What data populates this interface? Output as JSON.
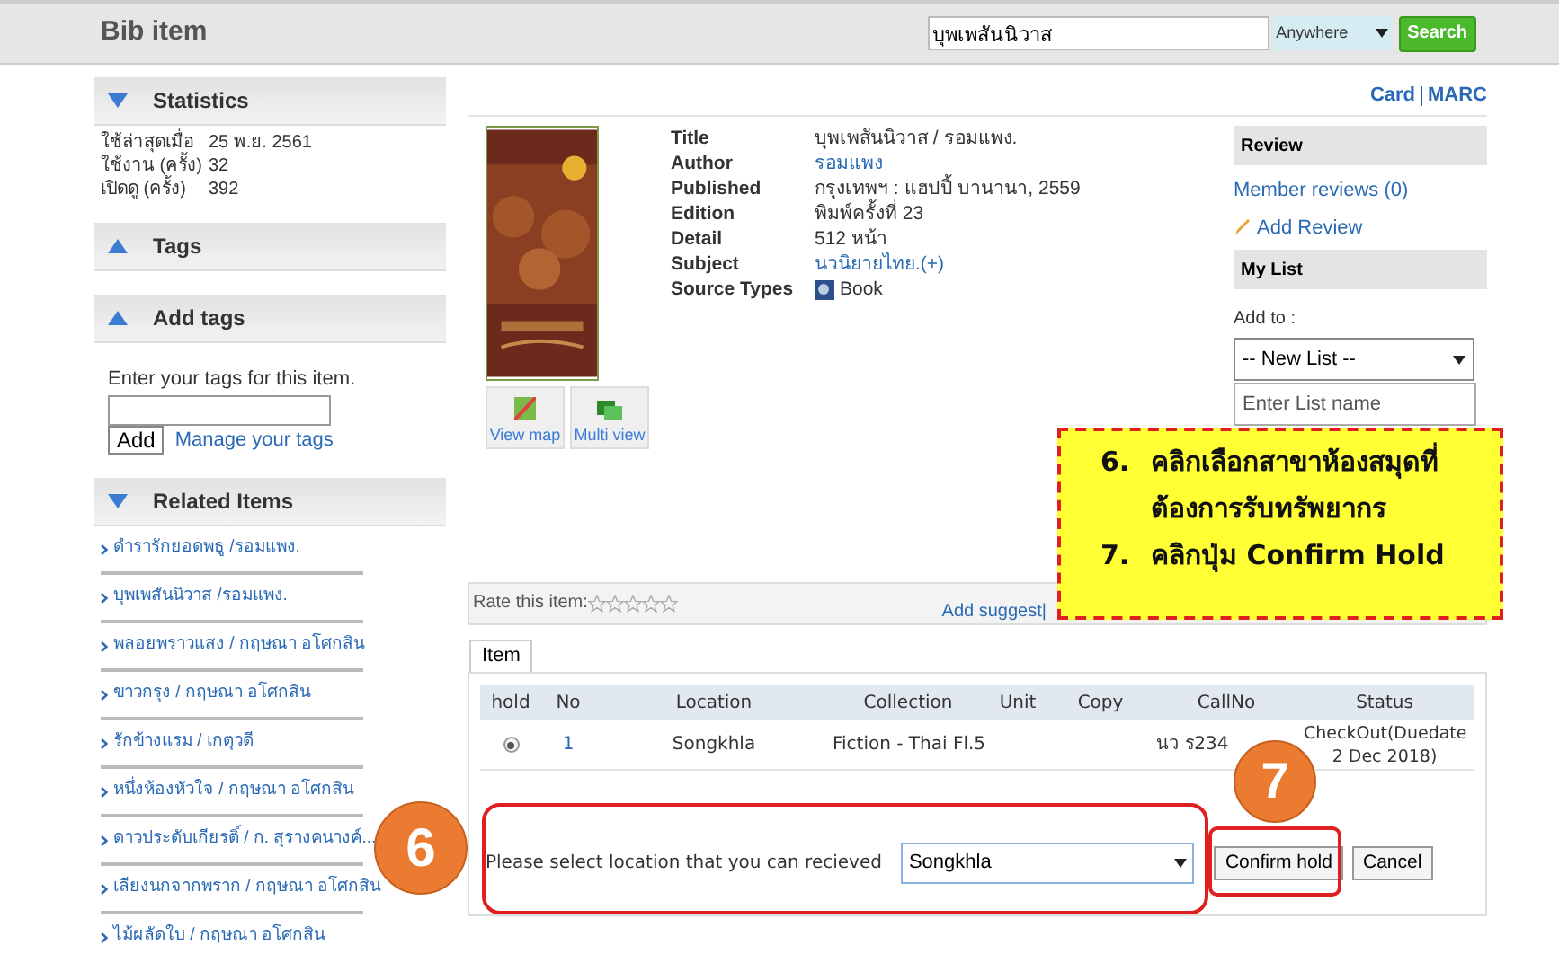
{
  "header": {
    "title": "Bib item",
    "search_value": "บุพเพสันนิวาส",
    "scope": "Anywhere",
    "search_button": "Search"
  },
  "sidebar": [
    {
      "title": "Statistics",
      "expanded": true,
      "kind": "stats",
      "rows": [
        {
          "label": "ใช้ล่าสุดเมื่อ",
          "value": "25 พ.ย. 2561"
        },
        {
          "label": "ใช้งาน (ครั้ง)",
          "value": "32"
        },
        {
          "label": "เปิดดู (ครั้ง)",
          "value": "392"
        }
      ]
    },
    {
      "title": "Tags",
      "expanded": false,
      "kind": "empty"
    },
    {
      "title": "Add tags",
      "expanded": false,
      "kind": "tags",
      "hint": "Enter your tags for this item.",
      "button": "Add",
      "link": "Manage your tags"
    },
    {
      "title": "Related Items",
      "expanded": true,
      "kind": "links",
      "items": [
        "ดำรารักยอดพธู /รอมแพง.",
        "บุพเพสันนิวาส /รอมแพง.",
        "พลอยพราวแสง / กฤษณา อโศกสิน",
        "ขาวกรุง / กฤษณา อโศกสิน",
        "รักข้างแรม / เกตุวดี",
        "หนึ่งห้องหัวใจ / กฤษณา อโศกสิน",
        "ดาวประดับเกียรติ์ / ก. สุรางคนางค์...",
        "เลียงนกจากพราก / กฤษณา อโศกสิน",
        "ไม้ผลัดใบ / กฤษณา อโศกสิน"
      ]
    }
  ],
  "views": [
    "Card",
    "MARC"
  ],
  "record": {
    "fields": [
      {
        "label": "Title",
        "value": "บุพเพสันนิวาส / รอมแพง.",
        "kind": "text"
      },
      {
        "label": "Author",
        "value": "รอมแพง",
        "kind": "link"
      },
      {
        "label": "Published",
        "value": "กรุงเทพฯ : แฮปปี้ บานานา, 2559",
        "kind": "text"
      },
      {
        "label": "Edition",
        "value": "พิมพ์ครั้งที่ 23",
        "kind": "text"
      },
      {
        "label": "Detail",
        "value": "512 หน้า",
        "kind": "text"
      },
      {
        "label": "Subject",
        "value": "นวนิยายไทย.(+)",
        "kind": "link"
      },
      {
        "label": "Source Types",
        "value": "Book",
        "kind": "type"
      }
    ],
    "cover_buttons": [
      "View map",
      "Multi view"
    ]
  },
  "review": {
    "title": "Review",
    "member_reviews": "Member reviews (0)",
    "add_review": "Add Review"
  },
  "my_list": {
    "title": "My List",
    "add_to": "Add to :",
    "list_value": "-- New List --",
    "name_placeholder": "Enter List name"
  },
  "rating": {
    "label": "Rate this item:",
    "stars": 0,
    "links": [
      "Add suggest|"
    ]
  },
  "tabs": [
    {
      "label": "Item",
      "selected": true
    }
  ],
  "items": {
    "columns": [
      "hold",
      "No",
      "Location",
      "Collection",
      "Unit",
      "Copy",
      "CallNo",
      "Status"
    ],
    "rows": [
      {
        "selected": true,
        "no": "1",
        "location": "Songkhla",
        "collection": "Fiction - Thai Fl.5",
        "unit": "",
        "copy": "",
        "call_no": "นว ร234",
        "status": "CheckOut(Duedate 2 Dec 2018)"
      }
    ]
  },
  "hold_form": {
    "label": "Please select location that you can recieved",
    "location": "Songkhla",
    "confirm": "Confirm hold",
    "cancel": "Cancel"
  },
  "callout": {
    "steps": [
      {
        "number": "6.",
        "text": "คลิกเลือกสาขาห้องสมุดที่ต้องการรับทรัพยากร"
      },
      {
        "number": "7.",
        "text": "คลิกปุ่ม Confirm Hold"
      }
    ]
  },
  "step_badges": [
    "6",
    "7"
  ]
}
